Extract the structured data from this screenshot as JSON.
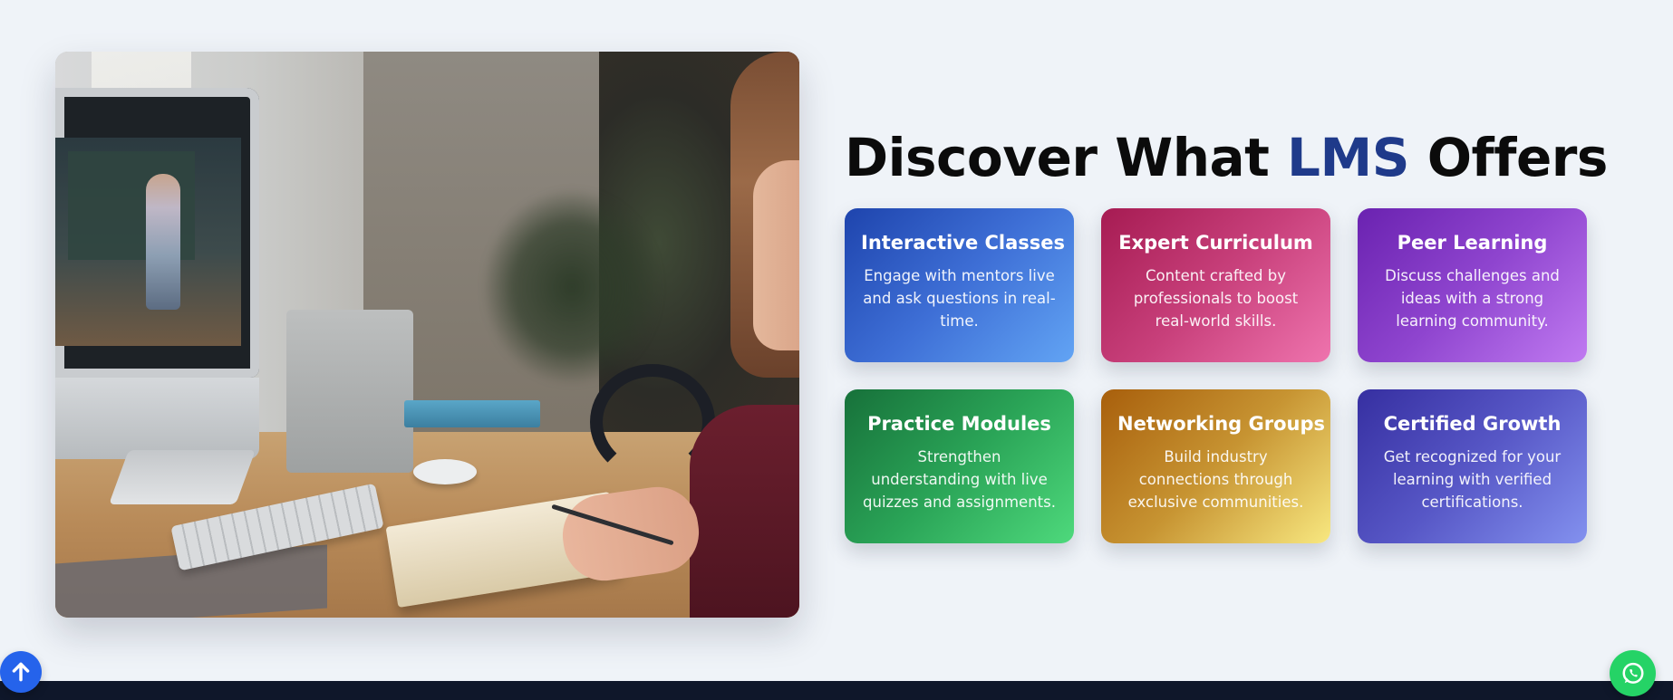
{
  "heading": {
    "prefix": "Discover What ",
    "highlight": "LMS",
    "suffix": " Offers"
  },
  "hero_image": {
    "alt": "Student attending an online class at a desk",
    "icon": "hero-photo"
  },
  "features": [
    {
      "title": "Interactive Classes",
      "description": "Engage with mentors live and ask questions in real-time.",
      "color": "#3e6fd6"
    },
    {
      "title": "Expert Curriculum",
      "description": "Content crafted by professionals to boost real-world skills.",
      "color": "#c8407b"
    },
    {
      "title": "Peer Learning",
      "description": "Discuss challenges and ideas with a strong learning community.",
      "color": "#8f45cf"
    },
    {
      "title": "Practice Modules",
      "description": "Strengthen understanding with live quizzes and assignments.",
      "color": "#2aa457"
    },
    {
      "title": "Networking Groups",
      "description": "Build industry connections through exclusive communities.",
      "color": "#c79432"
    },
    {
      "title": "Certified Growth",
      "description": "Get recognized for your learning with verified certifications.",
      "color": "#5757c6"
    }
  ],
  "floating_buttons": {
    "scroll_top_icon": "arrow-up-icon",
    "whatsapp_icon": "whatsapp-icon"
  },
  "colors": {
    "accent": "#1f3a8a",
    "background": "#eff3f8",
    "footer": "#0f172a",
    "scroll_top": "#2563eb",
    "whatsapp": "#25d366"
  }
}
